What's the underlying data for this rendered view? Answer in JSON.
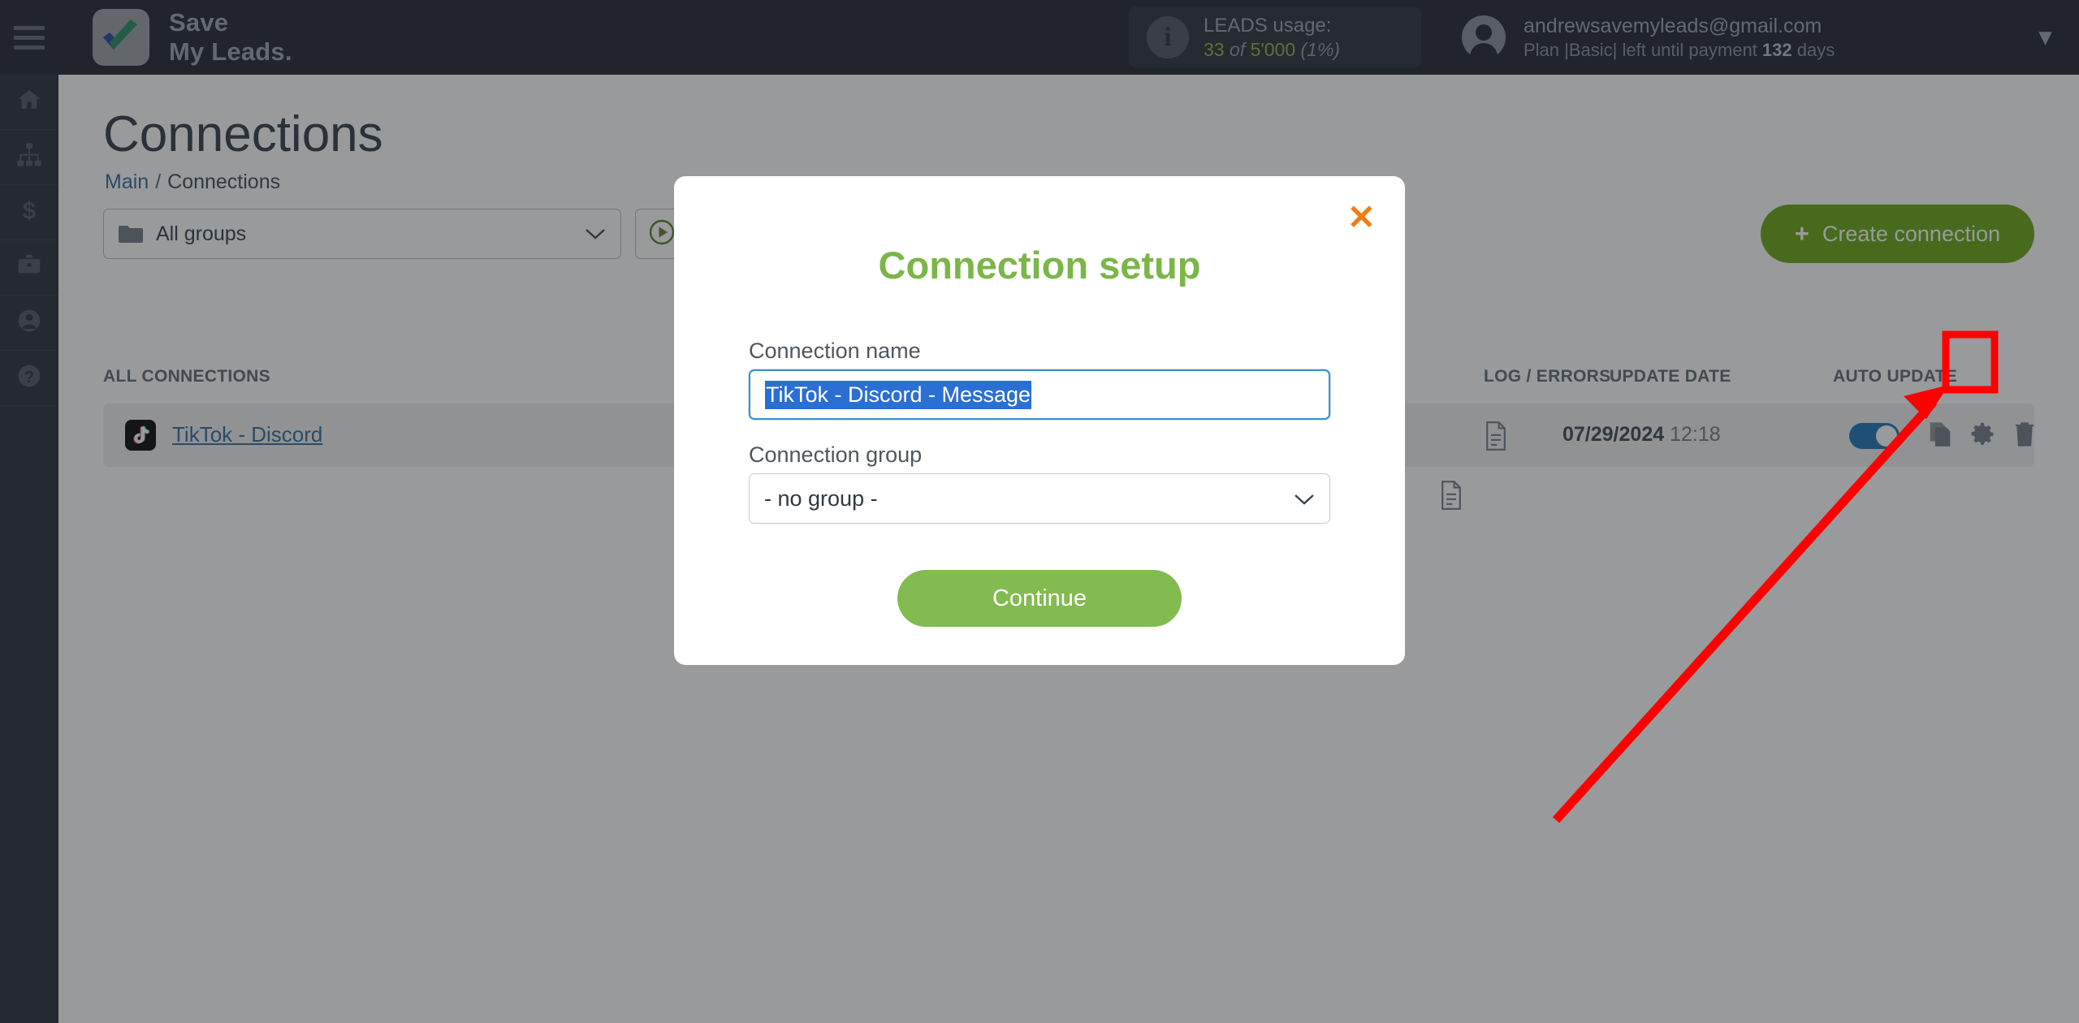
{
  "topbar": {
    "menu_icon": "hamburger-icon",
    "brand_line1": "Save",
    "brand_line2": "My Leads.",
    "leads": {
      "info_icon": "info-icon",
      "title": "LEADS usage:",
      "used": "33",
      "of": "of",
      "total": "5'000",
      "percent": "(1%)"
    },
    "account": {
      "avatar_icon": "user-avatar-icon",
      "email": "andrewsavemyleads@gmail.com",
      "plan_prefix": "Plan |Basic| left until payment",
      "plan_days": "132",
      "plan_suffix": "days",
      "caret_icon": "chevron-down-icon"
    }
  },
  "sidebar": {
    "items": [
      {
        "icon": "home-icon",
        "name": "home"
      },
      {
        "icon": "sitemap-icon",
        "name": "connections"
      },
      {
        "icon": "dollar-icon",
        "name": "payments"
      },
      {
        "icon": "briefcase-icon",
        "name": "business"
      },
      {
        "icon": "user-icon",
        "name": "profile"
      },
      {
        "icon": "question-icon",
        "name": "help"
      }
    ]
  },
  "page": {
    "title": "Connections",
    "breadcrumb": {
      "root": "Main",
      "separator": "/",
      "current": "Connections"
    },
    "groups_select": {
      "value": "All groups",
      "folder_icon": "folder-icon",
      "caret_icon": "chevron-down-icon"
    },
    "run_button": {
      "icon": "play-circle-icon"
    },
    "create_button": {
      "plus": "+",
      "label": "Create connection"
    },
    "columns": {
      "all_connections": "ALL CONNECTIONS",
      "log_errors": "LOG / ERRORS",
      "update_date": "UPDATE DATE",
      "auto_update": "AUTO UPDATE"
    },
    "rows": [
      {
        "service_icon": "tiktok-icon",
        "name": "TikTok - Discord",
        "log_icon": "document-icon",
        "date": "07/29/2024",
        "time": "12:18",
        "auto_update_on": true,
        "actions": [
          {
            "icon": "copy-icon",
            "name": "duplicate-connection"
          },
          {
            "icon": "gear-icon",
            "name": "connection-settings",
            "highlighted": true
          },
          {
            "icon": "trash-icon",
            "name": "delete-connection"
          }
        ]
      }
    ]
  },
  "modal": {
    "close_icon": "close-icon",
    "title": "Connection setup",
    "name_label": "Connection name",
    "name_value": "TikTok - Discord - Message",
    "group_label": "Connection group",
    "group_value": "- no group -",
    "group_caret_icon": "chevron-down-icon",
    "continue_label": "Continue"
  },
  "annotation": {
    "highlight_box_color": "#ff0000",
    "arrow_color": "#ff0000",
    "target": "connection-settings-gear"
  },
  "colors": {
    "brand_green": "#7ab648",
    "accent_orange": "#f07d12",
    "link_blue": "#2d6896",
    "toggle_blue": "#1a6fb5",
    "create_green": "#65a30d",
    "annotation_red": "#ff0000",
    "topbar_bg": "#1b2027",
    "sidebar_bg": "#232a33"
  }
}
